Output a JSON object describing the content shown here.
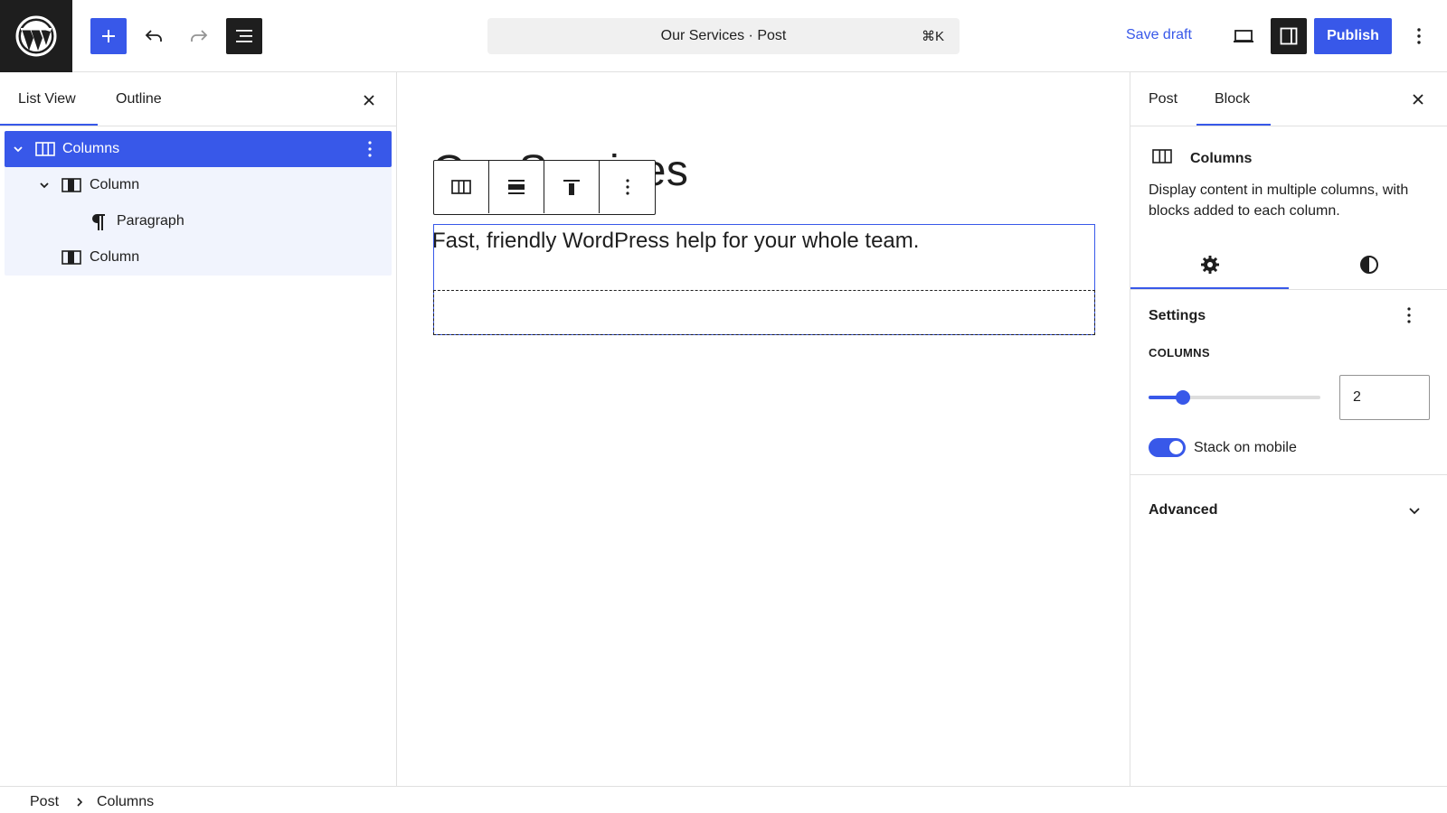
{
  "topbar": {
    "logo_icon": "wordpress-logo-icon",
    "add_icon": "plus-icon",
    "undo_icon": "undo-icon",
    "redo_icon": "redo-icon",
    "document_overview_icon": "list-overview-icon",
    "document_title": "Our Services · Post",
    "shortcut": "⌘K",
    "save_draft_label": "Save draft",
    "preview_icon": "laptop-icon",
    "settings_toggle_icon": "sidebar-icon",
    "publish_label": "Publish",
    "options_icon": "more-vertical-icon"
  },
  "left_panel": {
    "tabs": [
      {
        "label": "List View",
        "active": true
      },
      {
        "label": "Outline",
        "active": false
      }
    ],
    "tree": [
      {
        "label": "Columns",
        "icon": "columns-icon",
        "level": 1,
        "selected": true,
        "expanded": true
      },
      {
        "label": "Column",
        "icon": "column-icon",
        "level": 2,
        "selected": false,
        "expanded": true
      },
      {
        "label": "Paragraph",
        "icon": "paragraph-icon",
        "level": 3,
        "selected": false
      },
      {
        "label": "Column",
        "icon": "column-icon",
        "level": 2,
        "selected": false
      }
    ]
  },
  "canvas": {
    "title": "Our Services",
    "paragraph": "Fast, friendly WordPress help for your whole team."
  },
  "right_panel": {
    "tabs": [
      {
        "label": "Post",
        "active": false
      },
      {
        "label": "Block",
        "active": true
      }
    ],
    "block_title": "Columns",
    "block_description": "Display content in multiple columns, with blocks added to each column.",
    "settings_title": "Settings",
    "columns_label": "COLUMNS",
    "columns_value": "2",
    "columns_slider_fraction": 0.2,
    "stack_on_mobile_label": "Stack on mobile",
    "stack_on_mobile": true,
    "advanced_label": "Advanced"
  },
  "breadcrumb": {
    "items": [
      "Post",
      "Columns"
    ]
  },
  "colors": {
    "accent": "#3858e9",
    "dark": "#1e1e1e",
    "tree_bg": "#f1f4fd",
    "border": "#e0e0e0"
  }
}
